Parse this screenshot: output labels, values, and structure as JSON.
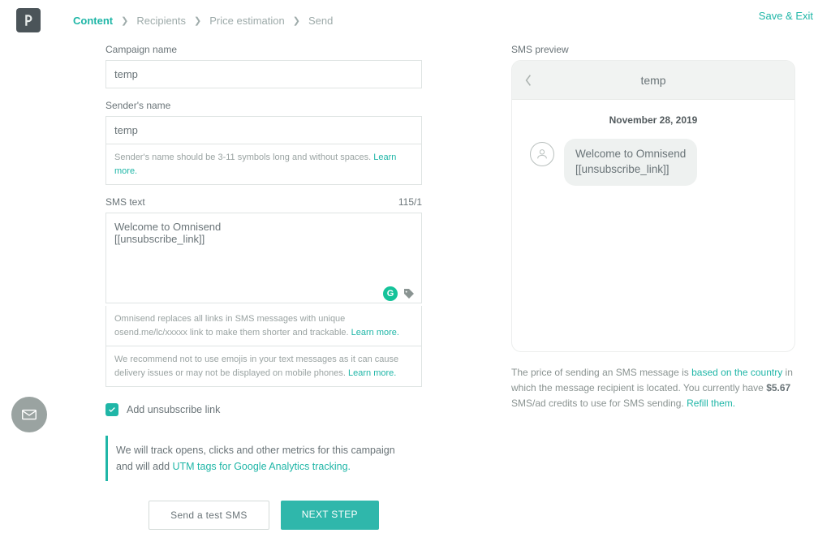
{
  "header": {
    "save_exit": "Save & Exit",
    "breadcrumb": [
      "Content",
      "Recipients",
      "Price estimation",
      "Send"
    ]
  },
  "form": {
    "campaign_name_label": "Campaign name",
    "campaign_name_value": "temp",
    "sender_name_label": "Sender's name",
    "sender_name_value": "temp",
    "sender_hint_text": "Sender's name should be 3-11 symbols long and without spaces. ",
    "sender_hint_link": "Learn more.",
    "sms_text_label": "SMS text",
    "char_count": "115/1",
    "sms_text_value": "Welcome to Omnisend\n[[unsubscribe_link]]",
    "sms_hint1_text": "Omnisend replaces all links in SMS messages with unique osend.me/lc/xxxxx link to make them shorter and trackable. ",
    "sms_hint1_link": "Learn more.",
    "sms_hint2_text": "We recommend not to use emojis in your text messages as it can cause delivery issues or may not be displayed on mobile phones. ",
    "sms_hint2_link": "Learn more.",
    "unsub_label": "Add unsubscribe link",
    "utm_text": "We will track opens, clicks and other metrics for this campaign and will add ",
    "utm_link": "UTM tags for Google Analytics tracking.",
    "send_test_btn": "Send a test SMS",
    "next_btn": "NEXT STEP"
  },
  "preview": {
    "label": "SMS preview",
    "title": "temp",
    "date": "November 28, 2019",
    "bubble_line1": "Welcome to Omnisend",
    "bubble_line2": "[[unsubscribe_link]]"
  },
  "price_note": {
    "p1": "The price of sending an SMS message is ",
    "link1": "based on the country",
    "p2": " in which the message recipient is located. You currently have ",
    "credits": "$5.67",
    "p3": " SMS/ad credits to use for SMS sending. ",
    "link2": "Refill them."
  }
}
